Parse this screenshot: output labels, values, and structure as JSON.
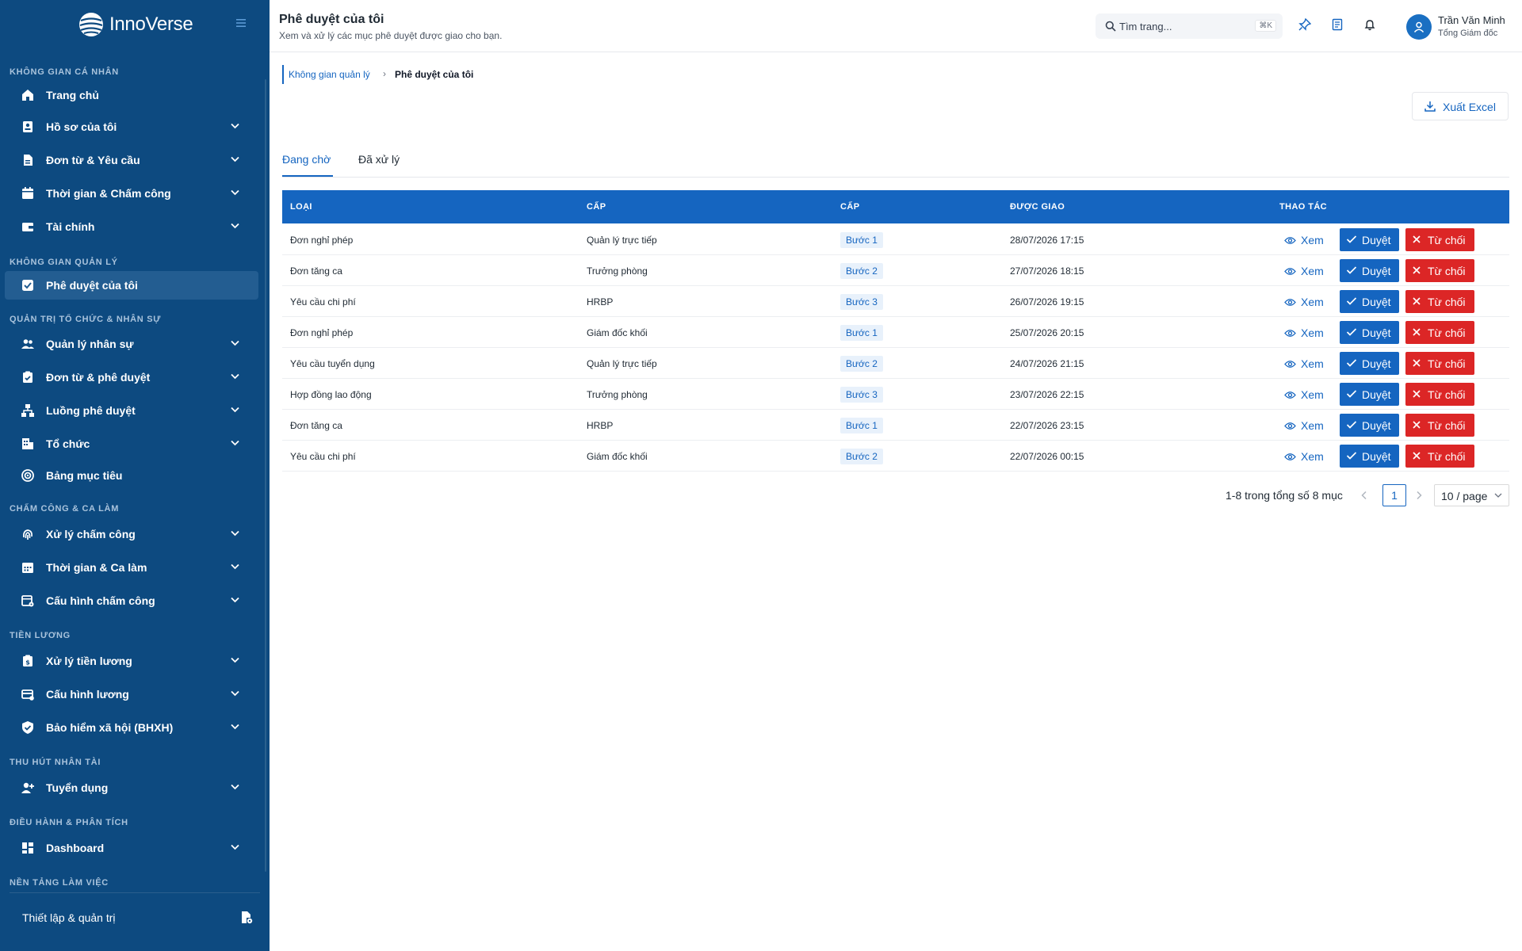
{
  "brand": {
    "name": "InnoVerse"
  },
  "colors": {
    "sidebar": "#0d4a80",
    "primary": "#1565c0",
    "danger": "#dc2626",
    "active_item": "#235d91"
  },
  "sidebar": {
    "sections": [
      {
        "title": "Không gian cá nhân"
      },
      {
        "title": "Không gian quản lý"
      },
      {
        "title": "Quản trị tổ chức & nhân sự"
      },
      {
        "title": "Chấm công & ca làm"
      },
      {
        "title": "Tiền lương"
      },
      {
        "title": "Thu hút nhân tài"
      },
      {
        "title": "Điều hành & phân tích"
      },
      {
        "title": "Nền tảng làm việc"
      }
    ],
    "items": [
      {
        "label": "Trang chủ",
        "icon": "home-icon",
        "expandable": false
      },
      {
        "label": "Hồ sơ của tôi",
        "icon": "profile-icon",
        "expandable": true
      },
      {
        "label": "Đơn từ & Yêu cầu",
        "icon": "document-icon",
        "expandable": true
      },
      {
        "label": "Thời gian & Chấm công",
        "icon": "calendar-icon",
        "expandable": true
      },
      {
        "label": "Tài chính",
        "icon": "wallet-icon",
        "expandable": true
      },
      {
        "label": "Phê duyệt của tôi",
        "icon": "checkbox-icon",
        "expandable": false,
        "active": true
      },
      {
        "label": "Quản lý nhân sự",
        "icon": "users-icon",
        "expandable": true
      },
      {
        "label": "Đơn từ & phê duyệt",
        "icon": "clipboard-check-icon",
        "expandable": true
      },
      {
        "label": "Luồng phê duyệt",
        "icon": "flow-icon",
        "expandable": true
      },
      {
        "label": "Tổ chức",
        "icon": "building-icon",
        "expandable": true
      },
      {
        "label": "Bảng mục tiêu",
        "icon": "target-icon",
        "expandable": false
      },
      {
        "label": "Xử lý chấm công",
        "icon": "fingerprint-icon",
        "expandable": true
      },
      {
        "label": "Thời gian & Ca làm",
        "icon": "calendar-grid-icon",
        "expandable": true
      },
      {
        "label": "Cấu hình chấm công",
        "icon": "calendar-settings-icon",
        "expandable": true
      },
      {
        "label": "Xử lý tiền lương",
        "icon": "payroll-icon",
        "expandable": true
      },
      {
        "label": "Cấu hình lương",
        "icon": "salary-config-icon",
        "expandable": true
      },
      {
        "label": "Bảo hiểm xã hội (BHXH)",
        "icon": "shield-check-icon",
        "expandable": true
      },
      {
        "label": "Tuyển dụng",
        "icon": "user-add-icon",
        "expandable": true
      },
      {
        "label": "Dashboard",
        "icon": "dashboard-icon",
        "expandable": true
      }
    ],
    "settings": {
      "label": "Thiết lập & quản trị",
      "icon": "settings-doc-icon"
    }
  },
  "header": {
    "title": "Phê duyệt của tôi",
    "subtitle": "Xem và xử lý các mục phê duyệt được giao cho bạn.",
    "search": {
      "placeholder": "Tìm trang...",
      "shortcut": "⌘K"
    },
    "user": {
      "name": "Trần Văn Minh",
      "role": "Tổng Giám đốc"
    }
  },
  "breadcrumb": {
    "parent": "Không gian quản lý",
    "separator": "›",
    "current": "Phê duyệt của tôi"
  },
  "toolbar": {
    "export_label": "Xuất Excel"
  },
  "tabs": [
    {
      "label": "Đang chờ",
      "active": true
    },
    {
      "label": "Đã xử lý",
      "active": false
    }
  ],
  "table": {
    "columns": [
      "Loại",
      "Cấp",
      "Cấp",
      "Được giao",
      "Thao tác"
    ],
    "actions": {
      "view": "Xem",
      "approve": "Duyệt",
      "reject": "Từ chối"
    },
    "rows": [
      {
        "type": "Đơn nghỉ phép",
        "level": "Quản lý trực tiếp",
        "step": "Bước 1",
        "assigned": "28/07/2026 17:15"
      },
      {
        "type": "Đơn tăng ca",
        "level": "Trưởng phòng",
        "step": "Bước 2",
        "assigned": "27/07/2026 18:15"
      },
      {
        "type": "Yêu cầu chi phí",
        "level": "HRBP",
        "step": "Bước 3",
        "assigned": "26/07/2026 19:15"
      },
      {
        "type": "Đơn nghỉ phép",
        "level": "Giám đốc khối",
        "step": "Bước 1",
        "assigned": "25/07/2026 20:15"
      },
      {
        "type": "Yêu cầu tuyển dụng",
        "level": "Quản lý trực tiếp",
        "step": "Bước 2",
        "assigned": "24/07/2026 21:15"
      },
      {
        "type": "Hợp đồng lao động",
        "level": "Trưởng phòng",
        "step": "Bước 3",
        "assigned": "23/07/2026 22:15"
      },
      {
        "type": "Đơn tăng ca",
        "level": "HRBP",
        "step": "Bước 1",
        "assigned": "22/07/2026 23:15"
      },
      {
        "type": "Yêu cầu chi phí",
        "level": "Giám đốc khối",
        "step": "Bước 2",
        "assigned": "22/07/2026 00:15"
      }
    ]
  },
  "pagination": {
    "total_text": "1-8 trong tổng số 8 mục",
    "current_page": "1",
    "page_size": "10 / page"
  }
}
